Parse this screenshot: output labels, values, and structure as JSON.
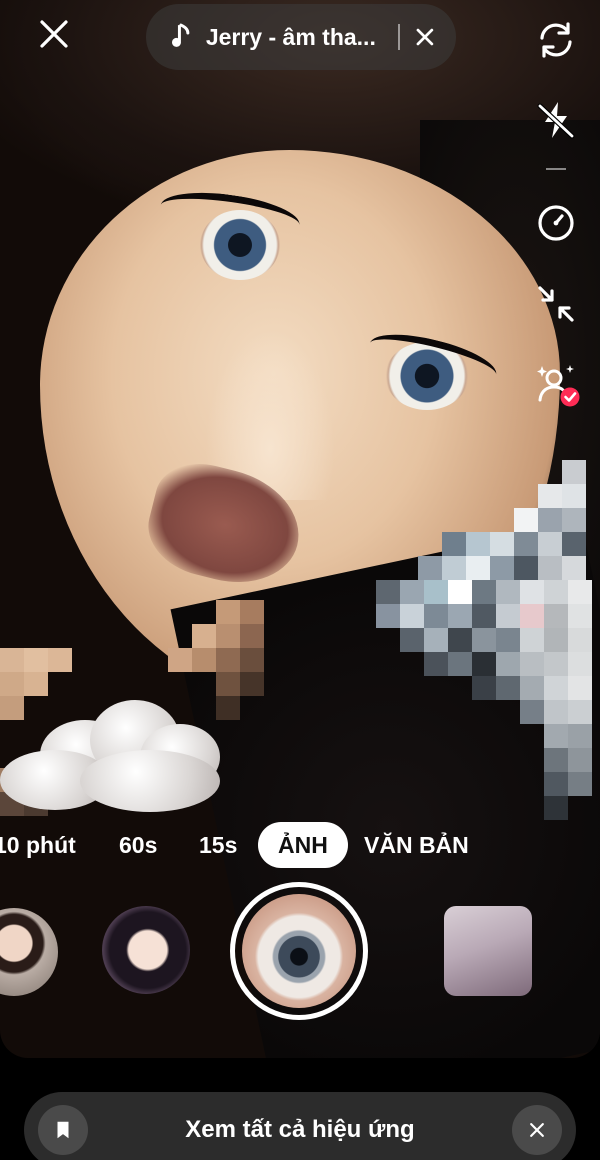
{
  "top_bar": {
    "music_title": "Jerry - âm tha..."
  },
  "modes": {
    "items": [
      "10 phút",
      "60s",
      "15s",
      "ẢNH",
      "VĂN BẢN"
    ],
    "active": "ẢNH"
  },
  "bottom_bar": {
    "label": "Xem tất cả hiệu ứng"
  },
  "icons": {
    "close": "close-icon",
    "music": "music-note-icon",
    "music_remove": "close-icon",
    "flip_camera": "flip-camera-icon",
    "flash": "flash-off-icon",
    "timer": "timer-icon",
    "collapse": "collapse-icon",
    "beauty": "beauty-person-check-icon",
    "bookmark": "bookmark-icon",
    "dismiss": "close-icon"
  },
  "colors": {
    "accent_red": "#fe2c55",
    "pill_bg": "#3c3c3c",
    "bottom_bar_bg": "#2c2c2c"
  }
}
